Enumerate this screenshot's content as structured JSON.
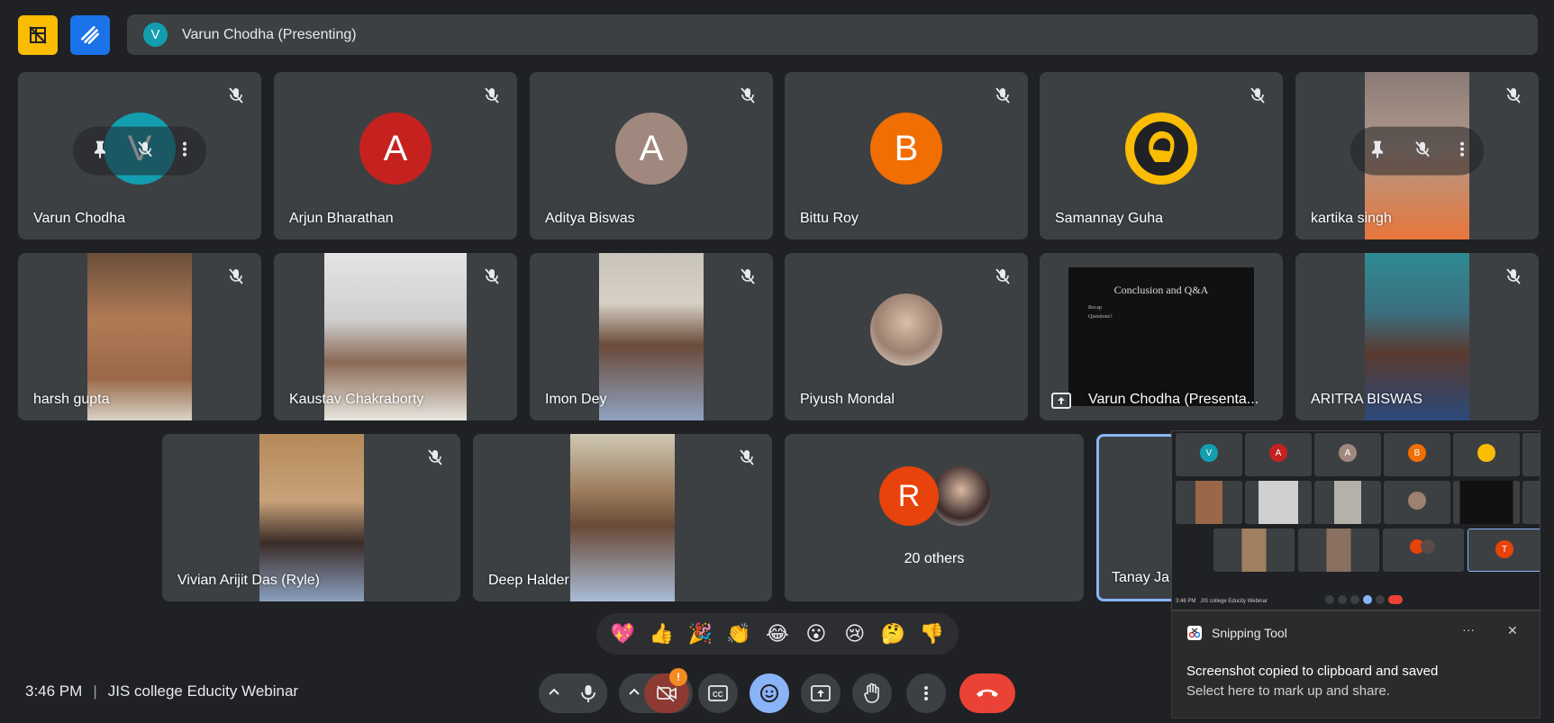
{
  "presenting": {
    "initial": "V",
    "label": "Varun Chodha (Presenting)"
  },
  "tiles": [
    {
      "name": "Varun Chodha",
      "initial": "V",
      "color": "#129eaf"
    },
    {
      "name": "Arjun Bharathan",
      "initial": "A",
      "color": "#c5221f"
    },
    {
      "name": "Aditya Biswas",
      "initial": "A",
      "color": "#a1887f"
    },
    {
      "name": "Bittu Roy",
      "initial": "B",
      "color": "#f06e02"
    },
    {
      "name": "Samannay Guha"
    },
    {
      "name": "kartika singh"
    },
    {
      "name": "harsh gupta"
    },
    {
      "name": "Kaustav Chakraborty"
    },
    {
      "name": "Imon Dey"
    },
    {
      "name": "Piyush Mondal"
    },
    {
      "name": "Varun Chodha (Presenta..."
    },
    {
      "name": "ARITRA BISWAS"
    },
    {
      "name": "Vivian Arijit Das (Ryle)"
    },
    {
      "name": "Deep Halder"
    },
    {
      "name": "Tanay Ja"
    }
  ],
  "others": {
    "initial": "R",
    "label": "20 others"
  },
  "slide": {
    "title": "Conclusion and Q&A",
    "bullet1": "Recap",
    "bullet2": "Questions?"
  },
  "reactions": [
    "💖",
    "👍",
    "🎉",
    "👏",
    "😂",
    "😮",
    "😢",
    "🤔",
    "👎"
  ],
  "meeting": {
    "time": "3:46 PM",
    "separator": "|",
    "title": "JIS college Educity Webinar"
  },
  "badge": "!",
  "toast": {
    "app": "Snipping Tool",
    "more": "···",
    "close": "✕",
    "line1": "Screenshot copied to clipboard and saved",
    "line2": "Select here to mark up and share."
  },
  "preview": {
    "initials": [
      "V",
      "A",
      "A",
      "B",
      ""
    ],
    "footer": "3:46 PM   JIS college Educity Webinar",
    "tanay_initial": "T"
  }
}
